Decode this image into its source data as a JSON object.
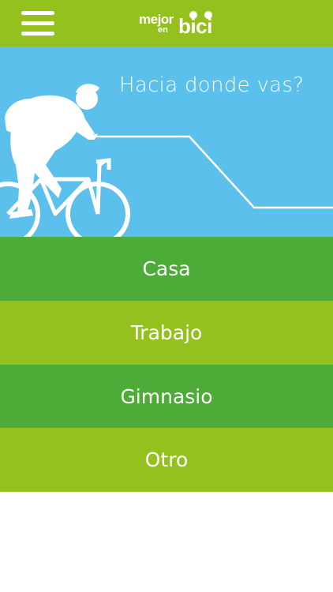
{
  "header": {
    "logo": {
      "word1": "mejor",
      "word2": "en",
      "word3": "bici"
    },
    "menu_icon": "hamburger-menu-icon"
  },
  "hero": {
    "title": "Hacia donde vas?",
    "illustration": "cyclist-silhouette-icon"
  },
  "destinations": [
    {
      "label": "Casa"
    },
    {
      "label": "Trabajo"
    },
    {
      "label": "Gimnasio"
    },
    {
      "label": "Otro"
    }
  ],
  "colors": {
    "header_green": "#95c11f",
    "option_dark_green": "#4dab37",
    "option_light_green": "#95c11f",
    "hero_blue": "#5bc0eb",
    "text": "#ffffff"
  }
}
